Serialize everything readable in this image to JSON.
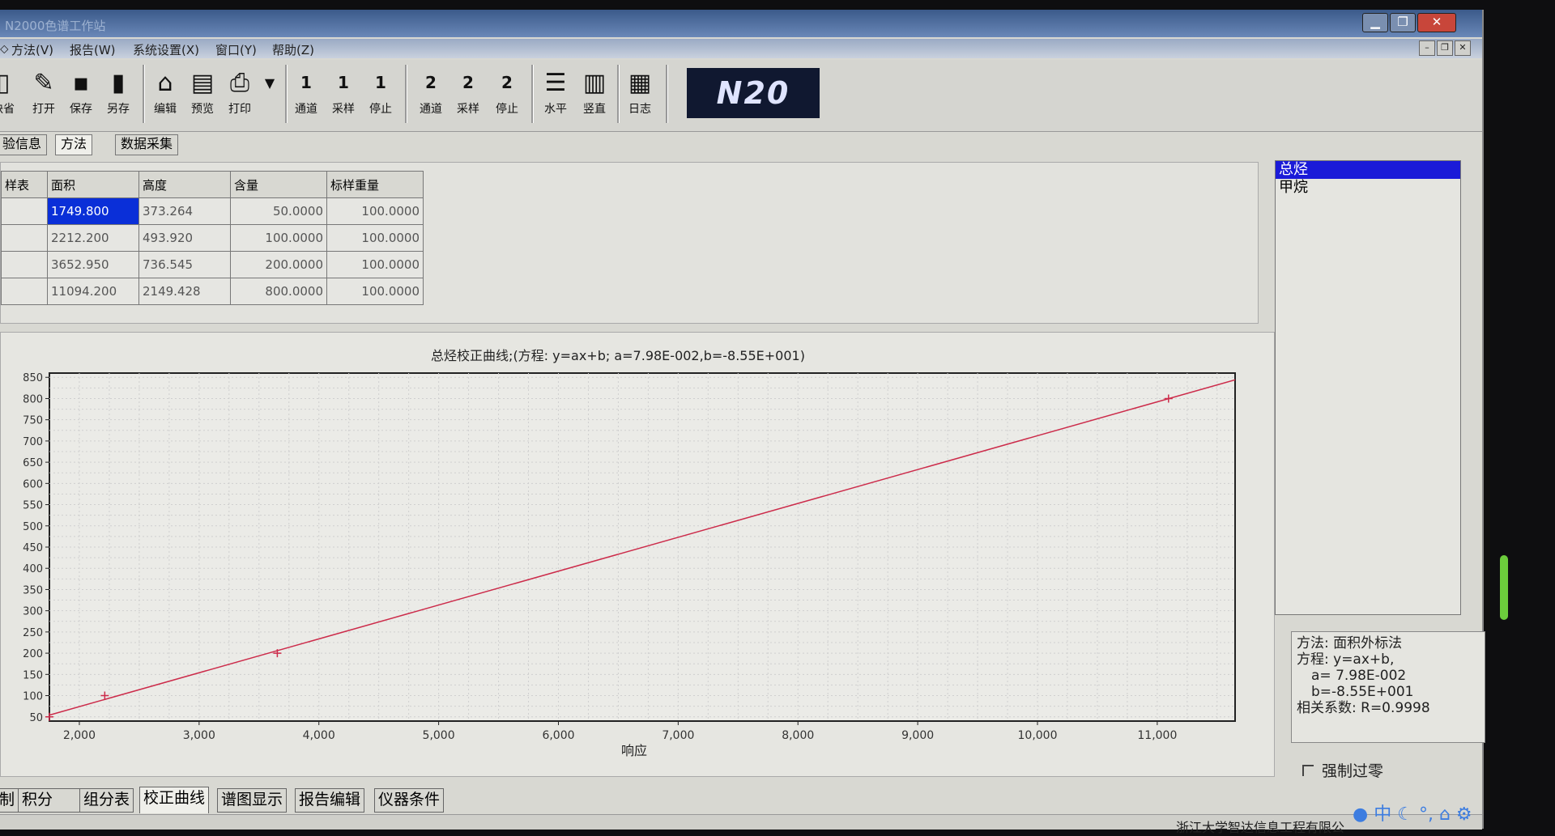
{
  "window": {
    "title": "N2000色谱工作站"
  },
  "menu": [
    "方法(V)",
    "报告(W)",
    "系统设置(X)",
    "窗口(Y)",
    "帮助(Z)"
  ],
  "toolbar": {
    "buttons": [
      "缺省",
      "打开",
      "保存",
      "另存",
      "编辑",
      "预览",
      "打印",
      "通道",
      "采样",
      "停止",
      "通道",
      "采样",
      "停止",
      "水平",
      "竖直",
      "日志"
    ],
    "channel_numbers": [
      "1",
      "1",
      "1",
      "2",
      "2",
      "2"
    ],
    "logo": "N20"
  },
  "subtabs": [
    "验信息",
    "方法",
    "数据采集"
  ],
  "table": {
    "headers": [
      "样表",
      "面积",
      "高度",
      "含量",
      "标样重量"
    ],
    "rows": [
      [
        "",
        "1749.800",
        "373.264",
        "50.0000",
        "100.0000"
      ],
      [
        "",
        "2212.200",
        "493.920",
        "100.0000",
        "100.0000"
      ],
      [
        "",
        "3652.950",
        "736.545",
        "200.0000",
        "100.0000"
      ],
      [
        "",
        "11094.200",
        "2149.428",
        "800.0000",
        "100.0000"
      ]
    ]
  },
  "chart_data": {
    "type": "line",
    "title": "总烃校正曲线;(方程: y=ax+b; a=7.98E-002,b=-8.55E+001)",
    "xlabel": "响应",
    "ylabel": "",
    "x_ticks": [
      "2,000",
      "3,000",
      "4,000",
      "5,000",
      "6,000",
      "7,000",
      "8,000",
      "9,000",
      "10,000",
      "11,000"
    ],
    "y_ticks": [
      "50",
      "100",
      "150",
      "200",
      "250",
      "300",
      "350",
      "400",
      "450",
      "500",
      "550",
      "600",
      "650",
      "700",
      "750",
      "800",
      "850"
    ],
    "xlim": [
      1750,
      11650
    ],
    "ylim": [
      40,
      860
    ],
    "points": {
      "x": [
        1749.8,
        2212.2,
        3652.95,
        11094.2
      ],
      "y": [
        50,
        100,
        200,
        800
      ]
    },
    "fit_line": {
      "x": [
        1750,
        11650
      ],
      "y": [
        54.1,
        844.1
      ]
    },
    "grid": true,
    "color": "#cc2b4a"
  },
  "components": [
    "总烃",
    "甲烷"
  ],
  "info": {
    "method": "方法: 面积外标法",
    "equation": "方程: y=ax+b,",
    "a": "a= 7.98E-002",
    "b": "b=-8.55E+001",
    "r": "相关系数: R=0.9998"
  },
  "force_zero_label": "强制过零",
  "bottom_tabs": [
    "制",
    "积分",
    "组分表",
    "校正曲线",
    "谱图显示",
    "报告编辑",
    "仪器条件"
  ],
  "status": {
    "company": "浙江大学智达信息工程有限公"
  },
  "tray": [
    "中"
  ]
}
